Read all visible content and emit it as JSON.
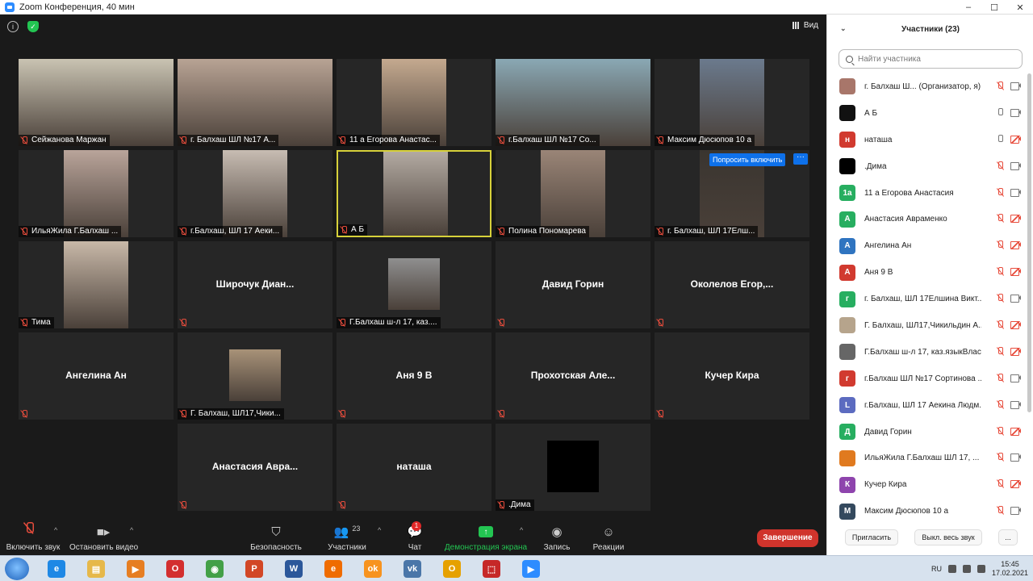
{
  "window": {
    "title": "Zoom Конференция, 40 мин",
    "minimize": "–",
    "maximize": "☐",
    "close": "✕"
  },
  "meeting": {
    "view_label": "Вид",
    "ask_unmute_label": "Попросить включить",
    "more_label": "···",
    "tiles": [
      {
        "label": "Сейжанова Маржан",
        "center_name": "",
        "video_color": "#c9c3b2"
      },
      {
        "label": "г. Балхаш ШЛ №17 А...",
        "center_name": "",
        "video_color": "#b8a394"
      },
      {
        "label": "11 а Егорова Анастас...",
        "center_name": "",
        "video_color": "#c4a98f"
      },
      {
        "label": "г.Балхаш ШЛ №17 Со...",
        "center_name": "",
        "video_color": "#8aa8b4"
      },
      {
        "label": "Максим Дюсюпов 10 а",
        "center_name": "",
        "video_color": "#6b7a8d"
      },
      {
        "label": "ИльяЖила  Г.Балхаш ...",
        "center_name": "",
        "video_color": "#b9a49a"
      },
      {
        "label": "г.Балхаш, ШЛ 17 Аеки...",
        "center_name": "",
        "video_color": "#c7bcb2"
      },
      {
        "label": "А Б",
        "center_name": "",
        "video_color": "#b3aaa2"
      },
      {
        "label": "Полина Пономарева",
        "center_name": "",
        "video_color": "#9a8577"
      },
      {
        "label": "г. Балхаш, ШЛ 17Елш...",
        "center_name": "",
        "video_color": "#3a3530"
      },
      {
        "label": "Тима",
        "center_name": "",
        "video_color": "#c8b8a8"
      },
      {
        "label": "",
        "center_name": "Широчук  Диан...",
        "video_color": ""
      },
      {
        "label": "Г.Балхаш ш-л 17, каз....",
        "center_name": "",
        "video_color": "#8f8f8f"
      },
      {
        "label": "",
        "center_name": "Давид Горин",
        "video_color": ""
      },
      {
        "label": "",
        "center_name": "Околелов  Егор,...",
        "video_color": ""
      },
      {
        "label": "",
        "center_name": "Ангелина Ан",
        "video_color": ""
      },
      {
        "label": "Г. Балхаш, ШЛ17,Чики...",
        "center_name": "",
        "video_color": "#a89278"
      },
      {
        "label": "",
        "center_name": "Аня 9 В",
        "video_color": ""
      },
      {
        "label": "",
        "center_name": "Прохотская  Але...",
        "video_color": ""
      },
      {
        "label": "",
        "center_name": "Кучер Кира",
        "video_color": ""
      },
      {
        "label": "",
        "center_name": "Анастасия  Авра...",
        "video_color": ""
      },
      {
        "label": "",
        "center_name": "наташа",
        "video_color": ""
      },
      {
        "label": ".Дима",
        "center_name": "",
        "video_color": "#000000"
      }
    ]
  },
  "toolbar": {
    "unmute_label": "Включить звук",
    "stop_video_label": "Остановить видео",
    "security_label": "Безопасность",
    "participants_label": "Участники",
    "participants_count": "23",
    "chat_label": "Чат",
    "chat_badge": "1",
    "share_label": "Демонстрация экрана",
    "record_label": "Запись",
    "reactions_label": "Реакции",
    "end_label": "Завершение",
    "caret": "^"
  },
  "panel": {
    "title": "Участники (23)",
    "search_placeholder": "Найти участника",
    "invite_label": "Пригласить",
    "mute_all_label": "Выкл. весь звук",
    "more_label": "...",
    "participants": [
      {
        "name": "г. Балхаш Ш...   (Организатор, я)",
        "initial": "",
        "color": "#a8766a",
        "mic": "off",
        "cam": "on"
      },
      {
        "name": "А Б",
        "initial": "",
        "color": "#111111",
        "mic": "on",
        "cam": "on"
      },
      {
        "name": "наташа",
        "initial": "н",
        "color": "#d13a2f",
        "mic": "on",
        "cam": "off"
      },
      {
        "name": ".Дима",
        "initial": "",
        "color": "#000000",
        "mic": "off",
        "cam": "on"
      },
      {
        "name": "11 а Егорова Анастасия",
        "initial": "1а",
        "color": "#27ae60",
        "mic": "off",
        "cam": "on"
      },
      {
        "name": "Анастасия Авраменко",
        "initial": "А",
        "color": "#27ae60",
        "mic": "off",
        "cam": "off"
      },
      {
        "name": "Ангелина Ан",
        "initial": "А",
        "color": "#2f74c0",
        "mic": "off",
        "cam": "off"
      },
      {
        "name": "Аня 9 В",
        "initial": "А",
        "color": "#d13a2f",
        "mic": "off",
        "cam": "off"
      },
      {
        "name": "г. Балхаш, ШЛ 17Елшина Викт...",
        "initial": "г",
        "color": "#27ae60",
        "mic": "off",
        "cam": "on"
      },
      {
        "name": "Г. Балхаш, ШЛ17,Чикильдин А...",
        "initial": "",
        "color": "#b6a48c",
        "mic": "off",
        "cam": "off"
      },
      {
        "name": "Г.Балхаш ш-л 17, каз.языкВлас...",
        "initial": "",
        "color": "#666666",
        "mic": "off",
        "cam": "off"
      },
      {
        "name": "г.Балхаш ШЛ №17 Сортинова ...",
        "initial": "г",
        "color": "#d13a2f",
        "mic": "off",
        "cam": "on"
      },
      {
        "name": "г.Балхаш, ШЛ 17 Аекина Людм...",
        "initial": "L",
        "color": "#5c6bc0",
        "mic": "off",
        "cam": "on"
      },
      {
        "name": "Давид Горин",
        "initial": "Д",
        "color": "#27ae60",
        "mic": "off",
        "cam": "off"
      },
      {
        "name": "ИльяЖила  Г.Балхаш ШЛ 17, ...",
        "initial": "",
        "color": "#e07a1f",
        "mic": "off",
        "cam": "on"
      },
      {
        "name": "Кучер Кира",
        "initial": "К",
        "color": "#8e44ad",
        "mic": "off",
        "cam": "off"
      },
      {
        "name": "Максим Дюсюпов 10 а",
        "initial": "М",
        "color": "#34495e",
        "mic": "off",
        "cam": "on"
      }
    ]
  },
  "taskbar": {
    "lang": "RU",
    "time": "15:45",
    "date": "17.02.2021",
    "apps": [
      {
        "name": "ie",
        "glyph": "e",
        "color": "#1e88e5"
      },
      {
        "name": "explorer",
        "glyph": "▤",
        "color": "#e6b84a"
      },
      {
        "name": "media",
        "glyph": "▶",
        "color": "#e67e22"
      },
      {
        "name": "opera",
        "glyph": "O",
        "color": "#d32f2f"
      },
      {
        "name": "chrome",
        "glyph": "◉",
        "color": "#43a047"
      },
      {
        "name": "powerpoint",
        "glyph": "P",
        "color": "#d24726"
      },
      {
        "name": "word",
        "glyph": "W",
        "color": "#2b579a"
      },
      {
        "name": "firefox",
        "glyph": "e",
        "color": "#ef6c00"
      },
      {
        "name": "odnoklassniki",
        "glyph": "ok",
        "color": "#f7931e"
      },
      {
        "name": "vk",
        "glyph": "vk",
        "color": "#4a76a8"
      },
      {
        "name": "outlook",
        "glyph": "O",
        "color": "#e6a100"
      },
      {
        "name": "pdf",
        "glyph": "⬚",
        "color": "#c62828"
      },
      {
        "name": "zoom",
        "glyph": "▶",
        "color": "#2d8cff"
      }
    ]
  }
}
